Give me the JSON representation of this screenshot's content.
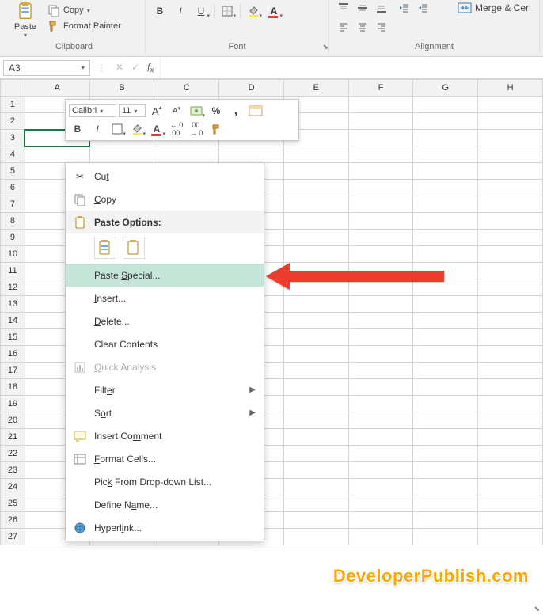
{
  "ribbon": {
    "clipboard": {
      "label": "Clipboard",
      "paste": "Paste",
      "copy": "Copy",
      "format_painter": "Format Painter"
    },
    "font": {
      "label": "Font",
      "name": "Calibri",
      "size": "11",
      "bold": "B",
      "italic": "I",
      "underline": "U"
    },
    "alignment": {
      "label": "Alignment",
      "merge": "Merge & Cer"
    }
  },
  "namebox": {
    "value": "A3"
  },
  "columns": [
    "A",
    "B",
    "C",
    "D",
    "E",
    "F",
    "G",
    "H"
  ],
  "row_count": 27,
  "selected_cell": {
    "row": 3,
    "col": "A"
  },
  "mini_toolbar": {
    "font_name": "Calibri",
    "font_size": "11",
    "bold": "B",
    "italic": "I",
    "percent": "%",
    "comma": ",",
    "inc_dec": ".0",
    "dec_dec": ".00"
  },
  "context_menu": {
    "cut": "Cut",
    "copy": "Copy",
    "paste_options": "Paste Options:",
    "paste_special": "Paste Special...",
    "insert": "Insert...",
    "delete": "Delete...",
    "clear_contents": "Clear Contents",
    "quick_analysis": "Quick Analysis",
    "filter": "Filter",
    "sort": "Sort",
    "insert_comment": "Insert Comment",
    "format_cells": "Format Cells...",
    "pick_list": "Pick From Drop-down List...",
    "define_name": "Define Name...",
    "hyperlink": "Hyperlink..."
  },
  "watermark": "DeveloperPublish.com"
}
